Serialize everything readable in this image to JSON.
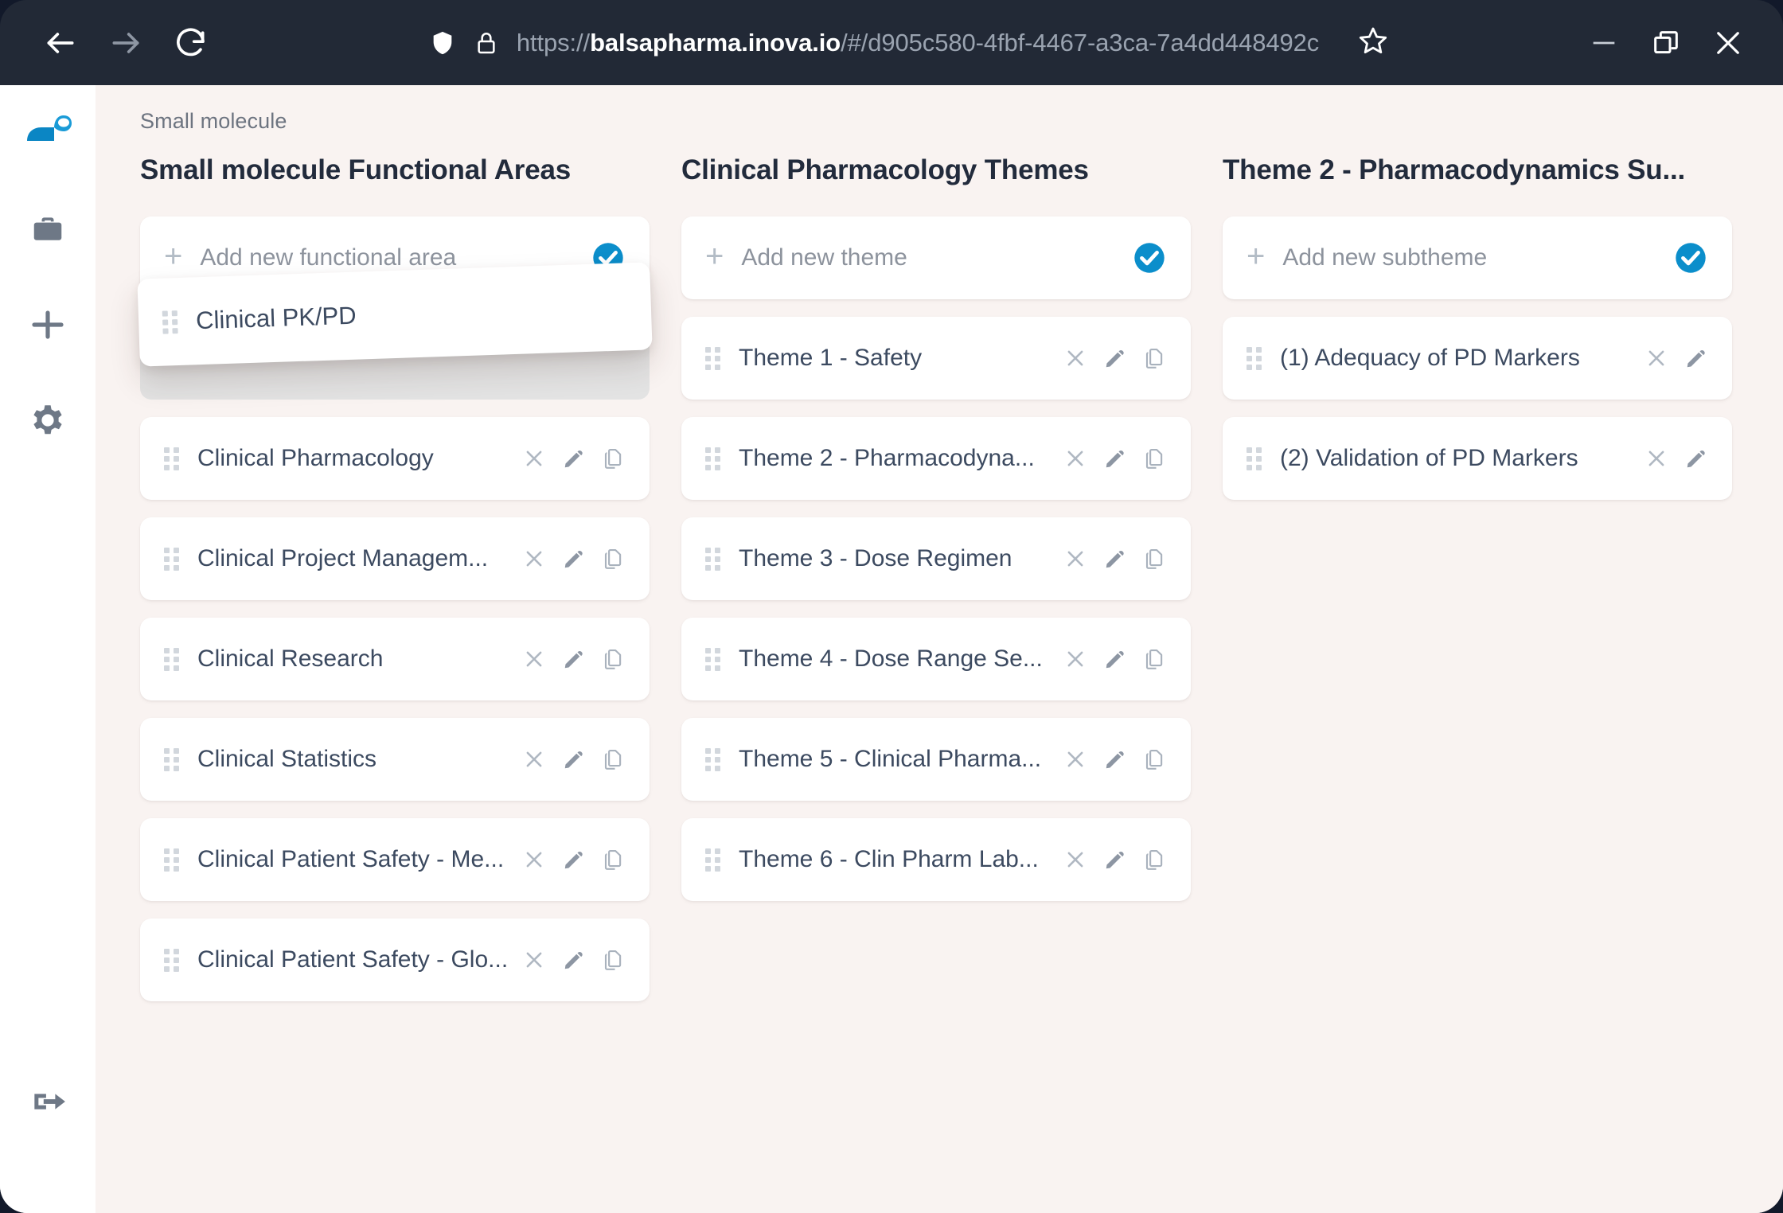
{
  "browser": {
    "url_dim_prefix": "https://",
    "url_bright": "balsapharma.inova.io",
    "url_dim_suffix": "/#/d905c580-4fbf-4467-a3ca-7a4dd448492c",
    "back_icon": "arrow-left-icon",
    "forward_icon": "arrow-right-icon",
    "reload_icon": "reload-icon",
    "shield_icon": "shield-icon",
    "lock_icon": "lock-icon",
    "bookmark_icon": "star-icon",
    "minimize_icon": "minimize-icon",
    "maximize_icon": "restore-icon",
    "close_icon": "close-icon"
  },
  "sidebar": {
    "logo": "inova-logo",
    "items": [
      {
        "icon": "briefcase-icon",
        "name": "sidebar-item-projects"
      },
      {
        "icon": "plus-icon",
        "name": "sidebar-item-add"
      },
      {
        "icon": "gear-icon",
        "name": "sidebar-item-settings"
      }
    ],
    "logout": {
      "icon": "logout-icon",
      "name": "sidebar-item-logout"
    }
  },
  "breadcrumb": "Small molecule",
  "accent_color": "#0b8ecb",
  "columns": [
    {
      "title": "Small molecule Functional Areas",
      "add_placeholder": "Add new functional area",
      "confirm_icon": "check-circle-icon",
      "dragging": {
        "label": "Clinical PK/PD",
        "grip_icon": "drag-handle-icon"
      },
      "items": [
        {
          "label": "Clinical Pharmacology",
          "actions": [
            "close-icon",
            "pencil-icon",
            "copy-icon"
          ]
        },
        {
          "label": "Clinical Project Managem...",
          "actions": [
            "close-icon",
            "pencil-icon",
            "copy-icon"
          ]
        },
        {
          "label": "Clinical Research",
          "actions": [
            "close-icon",
            "pencil-icon",
            "copy-icon"
          ]
        },
        {
          "label": "Clinical Statistics",
          "actions": [
            "close-icon",
            "pencil-icon",
            "copy-icon"
          ]
        },
        {
          "label": "Clinical Patient Safety - Me...",
          "actions": [
            "close-icon",
            "pencil-icon",
            "copy-icon"
          ]
        },
        {
          "label": "Clinical Patient Safety - Glo...",
          "actions": [
            "close-icon",
            "pencil-icon",
            "copy-icon"
          ]
        }
      ]
    },
    {
      "title": "Clinical Pharmacology Themes",
      "add_placeholder": "Add new theme",
      "confirm_icon": "check-circle-icon",
      "items": [
        {
          "label": "Theme 1 - Safety",
          "actions": [
            "close-icon",
            "pencil-icon",
            "copy-icon"
          ]
        },
        {
          "label": "Theme 2 - Pharmacodyna...",
          "actions": [
            "close-icon",
            "pencil-icon",
            "copy-icon"
          ]
        },
        {
          "label": "Theme 3 - Dose Regimen",
          "actions": [
            "close-icon",
            "pencil-icon",
            "copy-icon"
          ]
        },
        {
          "label": "Theme 4 - Dose Range Se...",
          "actions": [
            "close-icon",
            "pencil-icon",
            "copy-icon"
          ]
        },
        {
          "label": "Theme 5 - Clinical Pharma...",
          "actions": [
            "close-icon",
            "pencil-icon",
            "copy-icon"
          ]
        },
        {
          "label": "Theme 6 - Clin Pharm Lab...",
          "actions": [
            "close-icon",
            "pencil-icon",
            "copy-icon"
          ]
        }
      ]
    },
    {
      "title": "Theme 2 - Pharmacodynamics Su...",
      "add_placeholder": "Add new subtheme",
      "confirm_icon": "check-circle-icon",
      "items": [
        {
          "label": "(1) Adequacy of PD Markers",
          "actions": [
            "close-icon",
            "pencil-icon"
          ]
        },
        {
          "label": "(2) Validation of PD Markers",
          "actions": [
            "close-icon",
            "pencil-icon"
          ]
        }
      ]
    }
  ]
}
